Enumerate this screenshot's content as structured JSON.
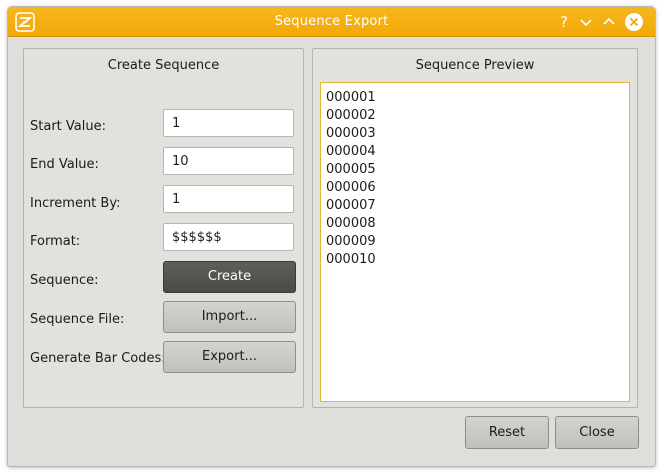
{
  "window": {
    "title": "Sequence Export"
  },
  "titlebar": {
    "help_glyph": "?"
  },
  "create_panel": {
    "title": "Create Sequence",
    "start_label": "Start Value:",
    "start_value": "1",
    "end_label": "End Value:",
    "end_value": "10",
    "increment_label": "Increment By:",
    "increment_value": "1",
    "format_label": "Format:",
    "format_value": "$$$$$$",
    "sequence_label": "Sequence:",
    "create_button": "Create",
    "file_label": "Sequence File:",
    "import_button": "Import...",
    "barcode_label": "Generate Bar Codes:",
    "export_button": "Export..."
  },
  "preview_panel": {
    "title": "Sequence Preview",
    "lines": [
      "000001",
      "000002",
      "000003",
      "000004",
      "000005",
      "000006",
      "000007",
      "000008",
      "000009",
      "000010"
    ]
  },
  "footer": {
    "reset_button": "Reset",
    "close_button": "Close"
  },
  "colors": {
    "titlebar": "#f4ab0f",
    "accent_border": "#e0b93a",
    "primary_button": "#545452"
  }
}
